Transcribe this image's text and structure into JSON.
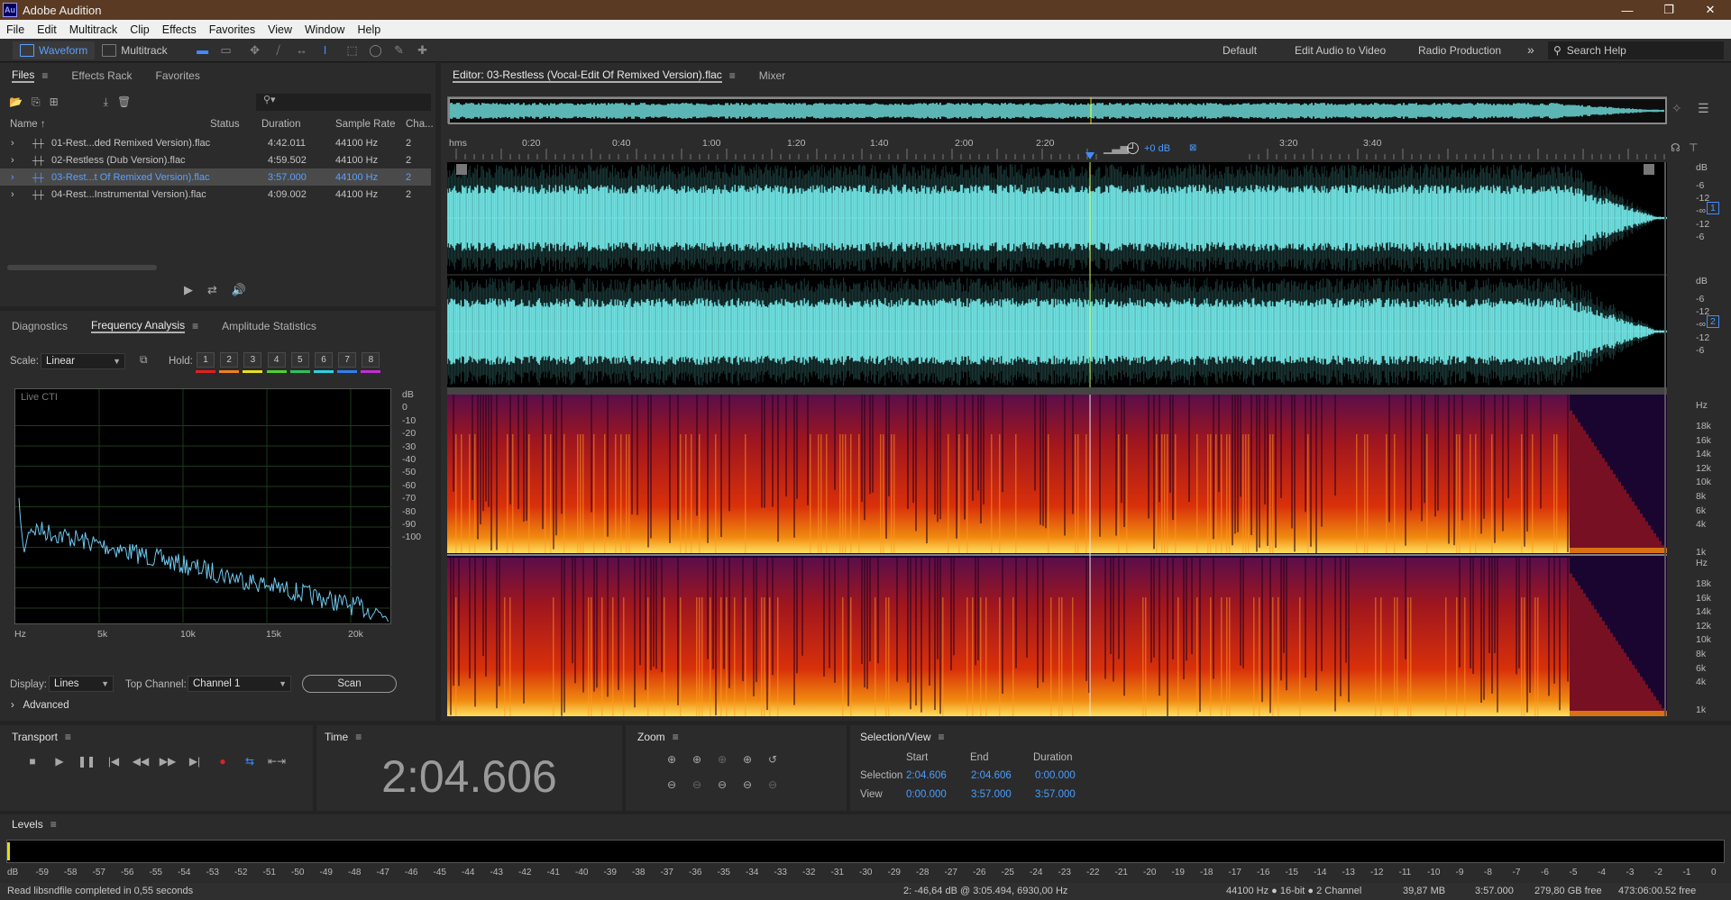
{
  "window": {
    "app_icon": "Au",
    "title": "Adobe Audition",
    "minimize": "—",
    "maximize": "❐",
    "close": "✕"
  },
  "menu": [
    "File",
    "Edit",
    "Multitrack",
    "Clip",
    "Effects",
    "Favorites",
    "View",
    "Window",
    "Help"
  ],
  "toolbar": {
    "waveform_label": "Waveform",
    "multitrack_label": "Multitrack",
    "workspaces": [
      "Default",
      "Edit Audio to Video",
      "Radio Production"
    ],
    "more": "»",
    "search_placeholder": "Search Help"
  },
  "files_panel": {
    "tabs": [
      "Files",
      "Effects Rack",
      "Favorites"
    ],
    "columns": [
      "Name",
      "Status",
      "Duration",
      "Sample Rate",
      "Cha..."
    ],
    "rows": [
      {
        "name": "01-Rest...ded Remixed Version).flac",
        "duration": "4:42.011",
        "rate": "44100 Hz",
        "ch": "2"
      },
      {
        "name": "02-Restless (Dub Version).flac",
        "duration": "4:59.502",
        "rate": "44100 Hz",
        "ch": "2"
      },
      {
        "name": "03-Rest...t Of Remixed Version).flac",
        "duration": "3:57.000",
        "rate": "44100 Hz",
        "ch": "2"
      },
      {
        "name": "04-Rest...Instrumental Version).flac",
        "duration": "4:09.002",
        "rate": "44100 Hz",
        "ch": "2"
      }
    ],
    "selected_row": 2
  },
  "analysis_panel": {
    "tabs": [
      "Diagnostics",
      "Frequency Analysis",
      "Amplitude Statistics"
    ],
    "scale_label": "Scale:",
    "scale_value": "Linear",
    "hold_label": "Hold:",
    "hold_buttons": [
      "1",
      "2",
      "3",
      "4",
      "5",
      "6",
      "7",
      "8"
    ],
    "hold_colors": [
      "#e02020",
      "#f08020",
      "#e8e020",
      "#50d030",
      "#30c060",
      "#30d0e0",
      "#3080f0",
      "#c030d0"
    ],
    "graph_label": "Live CTI",
    "db_labels": [
      "dB",
      "0",
      "-10",
      "-20",
      "-30",
      "-40",
      "-50",
      "-60",
      "-70",
      "-80",
      "-90",
      "-100"
    ],
    "hz_labels": [
      "Hz",
      "5k",
      "10k",
      "15k",
      "20k"
    ],
    "display_label": "Display:",
    "display_value": "Lines",
    "top_channel_label": "Top Channel:",
    "top_channel_value": "Channel 1",
    "scan_label": "Scan",
    "advanced_label": "Advanced"
  },
  "editor": {
    "tab_title": "Editor: 03-Restless (Vocal-Edit Of Remixed Version).flac",
    "mixer_tab": "Mixer",
    "time_labels": [
      "hms",
      "0:20",
      "0:40",
      "1:00",
      "1:20",
      "1:40",
      "2:00",
      "2:20",
      "3:00",
      "3:20",
      "3:40"
    ],
    "hud_gain": "+0 dB",
    "db_scale": [
      "dB",
      "-6",
      "-12",
      "-∞",
      "-12",
      "-6"
    ],
    "channel_numbers": [
      "1",
      "2"
    ],
    "hz_scale": [
      "Hz",
      "18k",
      "16k",
      "14k",
      "12k",
      "10k",
      "8k",
      "6k",
      "4k",
      "1k"
    ],
    "waveform_color": "#70e0e0",
    "playhead_fraction": 0.527
  },
  "transport": {
    "title": "Transport"
  },
  "time_panel": {
    "title": "Time",
    "value": "2:04.606"
  },
  "zoom_panel": {
    "title": "Zoom"
  },
  "selection_view": {
    "title": "Selection/View",
    "headers": [
      "Start",
      "End",
      "Duration"
    ],
    "rows": [
      {
        "label": "Selection",
        "start": "2:04.606",
        "end": "2:04.606",
        "duration": "0:00.000"
      },
      {
        "label": "View",
        "start": "0:00.000",
        "end": "3:57.000",
        "duration": "3:57.000"
      }
    ]
  },
  "levels": {
    "title": "Levels",
    "scale": [
      "dB",
      "-59",
      "-58",
      "-57",
      "-56",
      "-55",
      "-54",
      "-53",
      "-52",
      "-51",
      "-50",
      "-49",
      "-48",
      "-47",
      "-46",
      "-45",
      "-44",
      "-43",
      "-42",
      "-41",
      "-40",
      "-39",
      "-38",
      "-37",
      "-36",
      "-35",
      "-34",
      "-33",
      "-32",
      "-31",
      "-30",
      "-29",
      "-28",
      "-27",
      "-26",
      "-25",
      "-24",
      "-23",
      "-22",
      "-21",
      "-20",
      "-19",
      "-18",
      "-17",
      "-16",
      "-15",
      "-14",
      "-13",
      "-12",
      "-11",
      "-10",
      "-9",
      "-8",
      "-7",
      "-6",
      "-5",
      "-4",
      "-3",
      "-2",
      "-1",
      "0"
    ]
  },
  "status": {
    "message": "Read libsndfile completed in 0,55 seconds",
    "cursor": "2: -46,64 dB @ 3:05.494, 6930,00 Hz",
    "format": "44100 Hz ● 16-bit ● 2 Channel",
    "size": "39,87 MB",
    "duration": "3:57.000",
    "free": "279,80 GB free",
    "free_time": "473:06:00.52 free"
  }
}
